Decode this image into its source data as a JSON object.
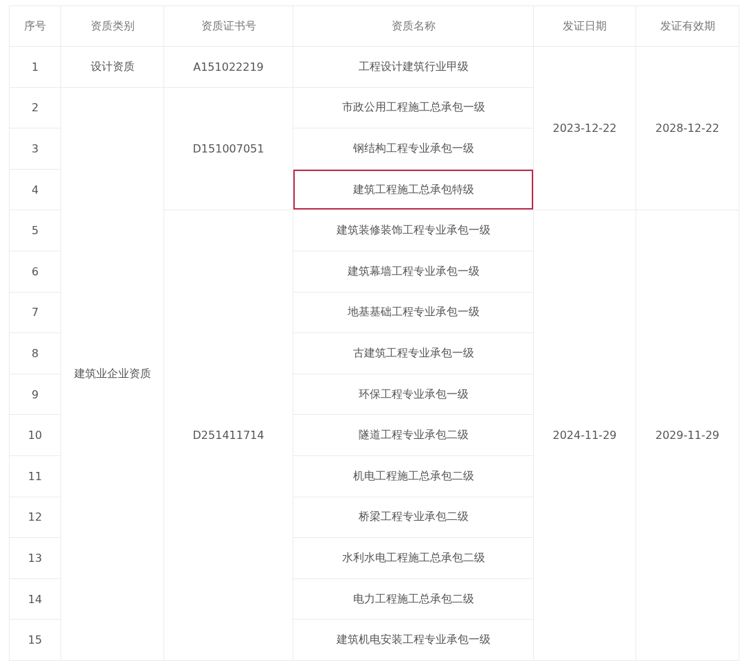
{
  "table": {
    "columns": [
      "序号",
      "资质类别",
      "资质证书号",
      "资质名称",
      "发证日期",
      "发证有效期"
    ],
    "rows": [
      {
        "no": "1",
        "category": "设计资质",
        "certificate": "A151022219",
        "name": "工程设计建筑行业甲级",
        "issue_date": "2023-12-22",
        "expiry_date": "2028-12-22",
        "highlighted": false
      },
      {
        "no": "2",
        "category": "建筑业企业资质",
        "certificate": "D151007051",
        "name": "市政公用工程施工总承包一级",
        "highlighted": false
      },
      {
        "no": "3",
        "name": "钢结构工程专业承包一级",
        "highlighted": false
      },
      {
        "no": "4",
        "name": "建筑工程施工总承包特级",
        "highlighted": true
      },
      {
        "no": "5",
        "certificate": "D251411714",
        "name": "建筑装修装饰工程专业承包一级",
        "issue_date": "2024-11-29",
        "expiry_date": "2029-11-29",
        "highlighted": false
      },
      {
        "no": "6",
        "name": "建筑幕墙工程专业承包一级",
        "highlighted": false
      },
      {
        "no": "7",
        "name": "地基基础工程专业承包一级",
        "highlighted": false
      },
      {
        "no": "8",
        "name": "古建筑工程专业承包一级",
        "highlighted": false
      },
      {
        "no": "9",
        "name": "环保工程专业承包一级",
        "highlighted": false
      },
      {
        "no": "10",
        "name": "隧道工程专业承包二级",
        "highlighted": false
      },
      {
        "no": "11",
        "name": "机电工程施工总承包二级",
        "highlighted": false
      },
      {
        "no": "12",
        "name": "桥梁工程专业承包二级",
        "highlighted": false
      },
      {
        "no": "13",
        "name": "水利水电工程施工总承包二级",
        "highlighted": false
      },
      {
        "no": "14",
        "name": "电力工程施工总承包二级",
        "highlighted": false
      },
      {
        "no": "15",
        "name": "建筑机电安装工程专业承包一级",
        "highlighted": false
      }
    ]
  }
}
